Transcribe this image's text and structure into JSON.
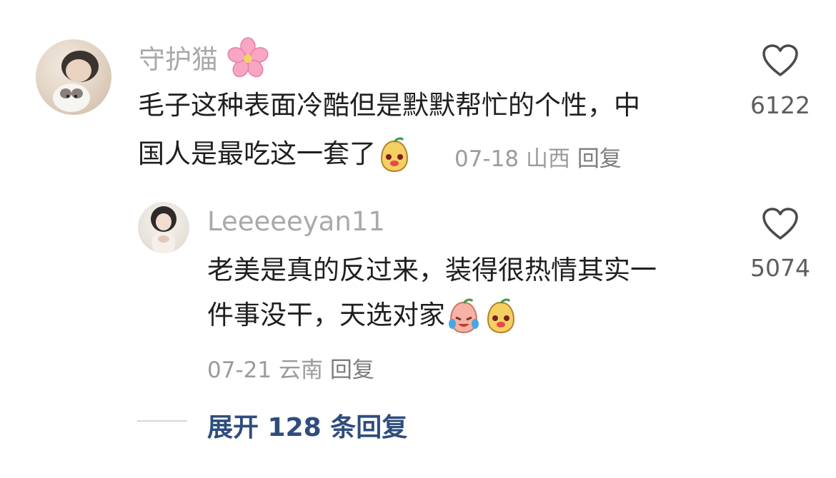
{
  "comments": [
    {
      "username": "守护猫",
      "username_icon": "cherry-blossom",
      "text_line1": "毛子这种表面冷酷但是默默帮忙的个性，中",
      "text_line2": "国人是最吃这一套了",
      "emojis": [
        "pear-mascot"
      ],
      "date": "07-18",
      "location": "山西",
      "reply_label": "回复",
      "likes": "6122"
    },
    {
      "username": "Leeeeeyan11",
      "text_line1": "老美是真的反过来，装得很热情其实一",
      "text_line2": "件事没干，天选对家",
      "emojis": [
        "crying-laugh-mascot",
        "pear-mascot"
      ],
      "date": "07-21",
      "location": "云南",
      "reply_label": "回复",
      "likes": "5074"
    }
  ],
  "expand_replies": "展开 128 条回复",
  "colors": {
    "username": "#a9a9a9",
    "body": "#1f1f1f",
    "meta": "#9b9b9b",
    "likes": "#5d5d5d",
    "expand_link": "#2e4d7d"
  },
  "icons": [
    "heart-outline-icon",
    "cherry-blossom-icon",
    "pear-mascot-icon",
    "crying-laugh-mascot-icon"
  ]
}
